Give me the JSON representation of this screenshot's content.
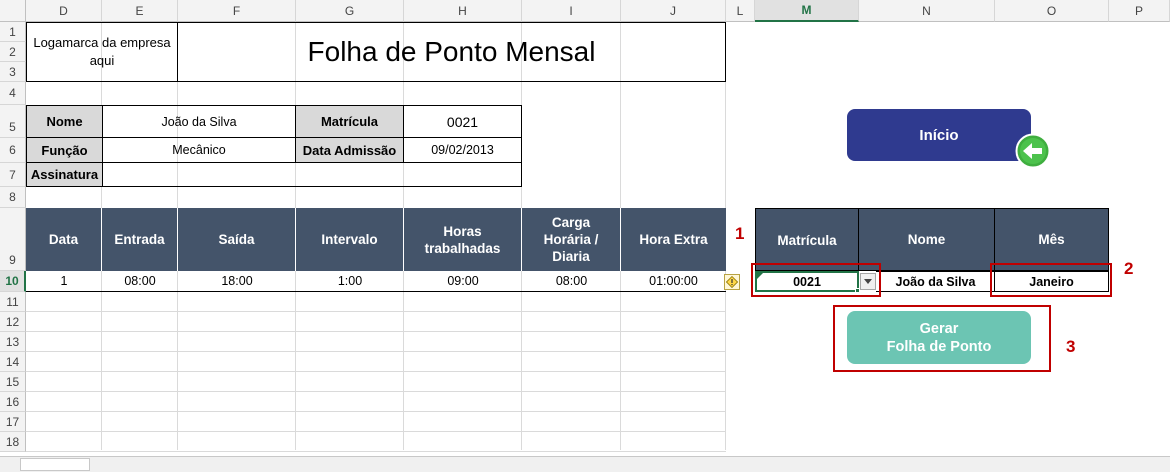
{
  "columns": [
    "D",
    "E",
    "F",
    "G",
    "H",
    "I",
    "J",
    "L",
    "M",
    "N",
    "O",
    "P"
  ],
  "rows": [
    "1",
    "2",
    "3",
    "4",
    "5",
    "6",
    "7",
    "8",
    "9",
    "10",
    "11",
    "12",
    "13",
    "14",
    "15",
    "16",
    "17",
    "18"
  ],
  "header": {
    "logo_text": "Logamarca da empresa aqui",
    "title": "Folha de Ponto Mensal"
  },
  "employee": {
    "nome_label": "Nome",
    "nome_value": "João da Silva",
    "matricula_label": "Matrícula",
    "matricula_value": "0021",
    "funcao_label": "Função",
    "funcao_value": "Mecânico",
    "admissao_label": "Data Admissão",
    "admissao_value": "09/02/2013",
    "assinatura_label": "Assinatura"
  },
  "timesheet": {
    "headers": [
      "Data",
      "Entrada",
      "Saída",
      "Intervalo",
      "Horas trabalhadas",
      "Carga Horária / Diaria",
      "Hora Extra"
    ],
    "row": [
      "1",
      "08:00",
      "18:00",
      "1:00",
      "09:00",
      "08:00",
      "01:00:00"
    ]
  },
  "lookup": {
    "headers": [
      "Matrícula",
      "Nome",
      "Mês"
    ],
    "matricula": "0021",
    "nome": "João da Silva",
    "mes": "Janeiro"
  },
  "buttons": {
    "inicio": "Início",
    "gerar_line1": "Gerar",
    "gerar_line2": "Folha de Ponto"
  },
  "annotations": [
    "1",
    "2",
    "3"
  ],
  "colors": {
    "header_fill": "#44546a",
    "inicio_button": "#2f3a8f",
    "gerar_button": "#6cc5b3",
    "annotation_red": "#c00000",
    "selection_green": "#217346"
  }
}
